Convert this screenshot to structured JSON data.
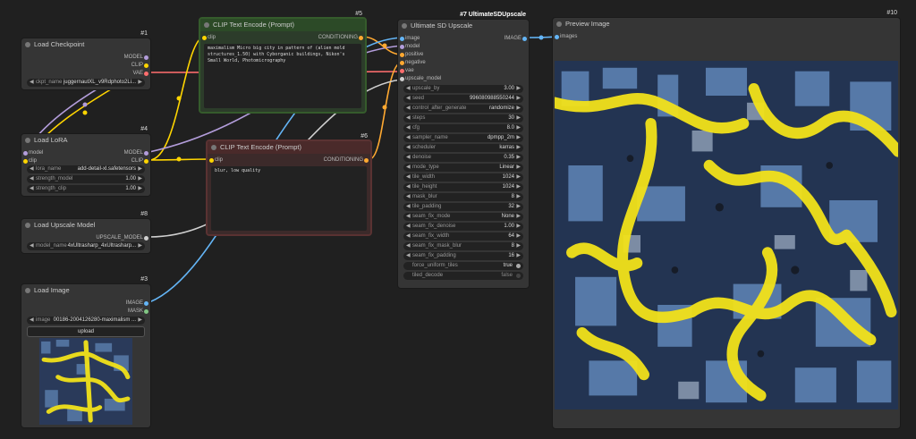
{
  "nodes": {
    "load_checkpoint": {
      "id": "#1",
      "title": "Load Checkpoint",
      "outputs": [
        "MODEL",
        "CLIP",
        "VAE"
      ],
      "ckpt_label": "ckpt_name",
      "ckpt_value": "juggernautXL_v9Rdphoto2Li..."
    },
    "load_lora": {
      "id": "#4",
      "title": "Load LoRA",
      "inputs": [
        "model",
        "clip"
      ],
      "outputs": [
        "MODEL",
        "CLIP"
      ],
      "widgets": [
        {
          "label": "lora_name",
          "value": "add-detail-xl.safetensors"
        },
        {
          "label": "strength_model",
          "value": "1.00"
        },
        {
          "label": "strength_clip",
          "value": "1.00"
        }
      ]
    },
    "load_upscale_model": {
      "id": "#8",
      "title": "Load Upscale Model",
      "output": "UPSCALE_MODEL",
      "widget_label": "model_name",
      "widget_value": "4xUltrasharp_4xUltrasharp..."
    },
    "load_image": {
      "id": "#3",
      "title": "Load Image",
      "outputs": [
        "IMAGE",
        "MASK"
      ],
      "image_label": "image",
      "image_value": "00186-2004126280-maximalism ...",
      "upload_label": "upload"
    },
    "clip_pos": {
      "id": "#5",
      "title": "CLIP Text Encode (Prompt)",
      "input": "clip",
      "output": "CONDITIONING",
      "text": "maximalism Micro big city in pattern of (alien mold structures_1.50) with Cyborganic buildings, Nikon's Small World, Photomicrography"
    },
    "clip_neg": {
      "id": "#6",
      "title": "CLIP Text Encode (Prompt)",
      "input": "clip",
      "output": "CONDITIONING",
      "text": "blur, low quality"
    },
    "ultimate_sd": {
      "id": "#7 UltimateSDUpscale",
      "title": "Ultimate SD Upscale",
      "inputs": [
        "image",
        "model",
        "positive",
        "negative",
        "vae",
        "upscale_model"
      ],
      "output": "IMAGE",
      "widgets": [
        {
          "label": "upscale_by",
          "value": "3.00"
        },
        {
          "label": "seed",
          "value": "996080988550244"
        },
        {
          "label": "control_after_generate",
          "value": "randomize"
        },
        {
          "label": "steps",
          "value": "30"
        },
        {
          "label": "cfg",
          "value": "8.0"
        },
        {
          "label": "sampler_name",
          "value": "dpmpp_2m"
        },
        {
          "label": "scheduler",
          "value": "karras"
        },
        {
          "label": "denoise",
          "value": "0.35"
        },
        {
          "label": "mode_type",
          "value": "Linear"
        },
        {
          "label": "tile_width",
          "value": "1024"
        },
        {
          "label": "tile_height",
          "value": "1024"
        },
        {
          "label": "mask_blur",
          "value": "8"
        },
        {
          "label": "tile_padding",
          "value": "32"
        },
        {
          "label": "seam_fix_mode",
          "value": "None"
        },
        {
          "label": "seam_fix_denoise",
          "value": "1.00"
        },
        {
          "label": "seam_fix_width",
          "value": "64"
        },
        {
          "label": "seam_fix_mask_blur",
          "value": "8"
        },
        {
          "label": "seam_fix_padding",
          "value": "16"
        }
      ],
      "toggles": [
        {
          "label": "force_uniform_tiles",
          "value": "true"
        },
        {
          "label": "tiled_decode",
          "value": "false"
        }
      ]
    },
    "preview_image": {
      "id": "#10",
      "title": "Preview Image",
      "input": "images"
    }
  },
  "colors": {
    "model": "#b39ddb",
    "clip": "#ffd500",
    "vae": "#ff6e6e",
    "conditioning": "#ffa931",
    "image": "#64b5f6",
    "mask": "#81c784",
    "upscale_model": "#d0d0d0",
    "mold": "#f2e21a",
    "city": "#2a3a5a"
  }
}
